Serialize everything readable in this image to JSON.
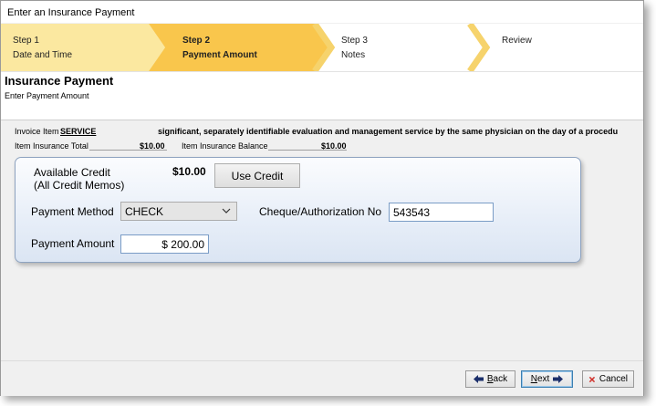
{
  "window": {
    "title": "Enter an Insurance Payment"
  },
  "wizard": {
    "steps": [
      {
        "num": "Step 1",
        "label": "Date and Time",
        "state": "done"
      },
      {
        "num": "Step 2",
        "label": "Payment Amount",
        "state": "current"
      },
      {
        "num": "Step 3",
        "label": "Notes",
        "state": "pending"
      },
      {
        "num": "",
        "label": "Review",
        "state": "pending"
      }
    ],
    "colors": {
      "done": "#fbe8a0",
      "current": "#f9c64c",
      "chevron": "#f4c23c"
    }
  },
  "header": {
    "title": "Insurance Payment",
    "subtitle": "Enter Payment Amount"
  },
  "invoice": {
    "item_label": "Invoice Item",
    "item_code": "SERVICE",
    "item_description": "significant, separately identifiable evaluation and management service by the same physician on the day of a procedu",
    "total_label": "Item Insurance Total",
    "total_value": "$10.00",
    "balance_label": "Item Insurance Balance",
    "balance_value": "$10.00"
  },
  "credit": {
    "label_line1": "Available Credit",
    "label_line2": "(All Credit Memos)",
    "amount": "$10.00",
    "use_credit_label": "Use Credit"
  },
  "payment": {
    "method_label": "Payment Method",
    "method_value": "CHECK",
    "cheque_label": "Cheque/Authorization No",
    "cheque_value": "543543",
    "amount_label": "Payment Amount",
    "amount_value": "$ 200.00"
  },
  "footer": {
    "back_pre": "",
    "back_u": "B",
    "back_post": "ack",
    "next_pre": "",
    "next_u": "N",
    "next_post": "ext",
    "cancel_label": "Cancel"
  }
}
